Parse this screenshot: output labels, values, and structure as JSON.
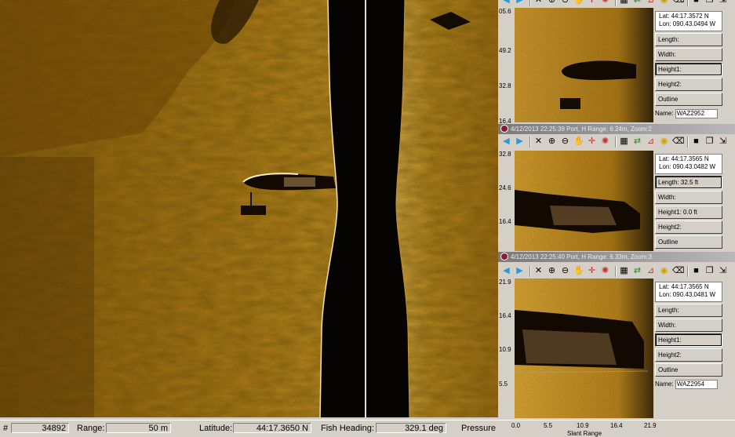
{
  "statusbar": {
    "hash_label": "#",
    "ping_value": "34892",
    "range_label": "Range:",
    "range_value": "50 m",
    "latitude_label": "Latitude:",
    "latitude_value": "44:17.3650 N",
    "heading_label": "Fish Heading:",
    "heading_value": "329.1 deg",
    "pressure_label": "Pressure"
  },
  "panels": [
    {
      "title": "",
      "scale": [
        "05.6",
        "49.2",
        "32.8",
        "16.4"
      ],
      "lat": "Lat:    44:17.3572 N",
      "lon": "Lon: 090.43.0494 W",
      "buttons": [
        "Length:",
        "Width:",
        "Height1:",
        "Height2:",
        "Outline"
      ],
      "pressed": 2,
      "name_label": "Name:",
      "name_value": "WAZ2952"
    },
    {
      "title": "4/12/2013 22:25:39 Port, H Range: 6.24m, Zoom:2",
      "scale": [
        "32.8",
        "24.6",
        "16.4"
      ],
      "lat": "Lat:    44:17.3565 N",
      "lon": "Lon: 090.43.0482 W",
      "buttons": [
        "Length:  32.5 ft",
        "Width:",
        "Height1:   0.0 ft",
        "Height2:",
        "Outline"
      ],
      "pressed": 0,
      "name_label": "",
      "name_value": ""
    },
    {
      "title": "4/12/2013 22:25:40 Port, H Range: 6.33m, Zoom:3",
      "scale": [
        "21.9",
        "16.4",
        "10.9",
        "5.5"
      ],
      "lat": "Lat:    44:17.3565 N",
      "lon": "Lon: 090.43.0481 W",
      "buttons": [
        "Length:",
        "Width:",
        "Height1:",
        "Height2:",
        "Outline"
      ],
      "pressed": 2,
      "name_label": "Name:",
      "name_value": "WAZ2954",
      "xaxis": [
        "0.0",
        "5.5",
        "10.9",
        "16.4",
        "21.9"
      ],
      "xlabel": "Slant Range"
    }
  ],
  "toolbar_icons": [
    "arrow-left-icon",
    "arrow-right-icon",
    "close-icon",
    "zoom-in-icon",
    "zoom-out-icon",
    "hand-icon",
    "crosshair-icon",
    "target-icon",
    "grid-icon",
    "swap-icon",
    "chart-icon",
    "palette-icon",
    "eraser-icon",
    "save-icon",
    "copy-icon",
    "export-icon"
  ],
  "colors": {
    "sonar_gold": "#c8901a",
    "sonar_dark": "#1a1005",
    "nadir": "#000000"
  }
}
